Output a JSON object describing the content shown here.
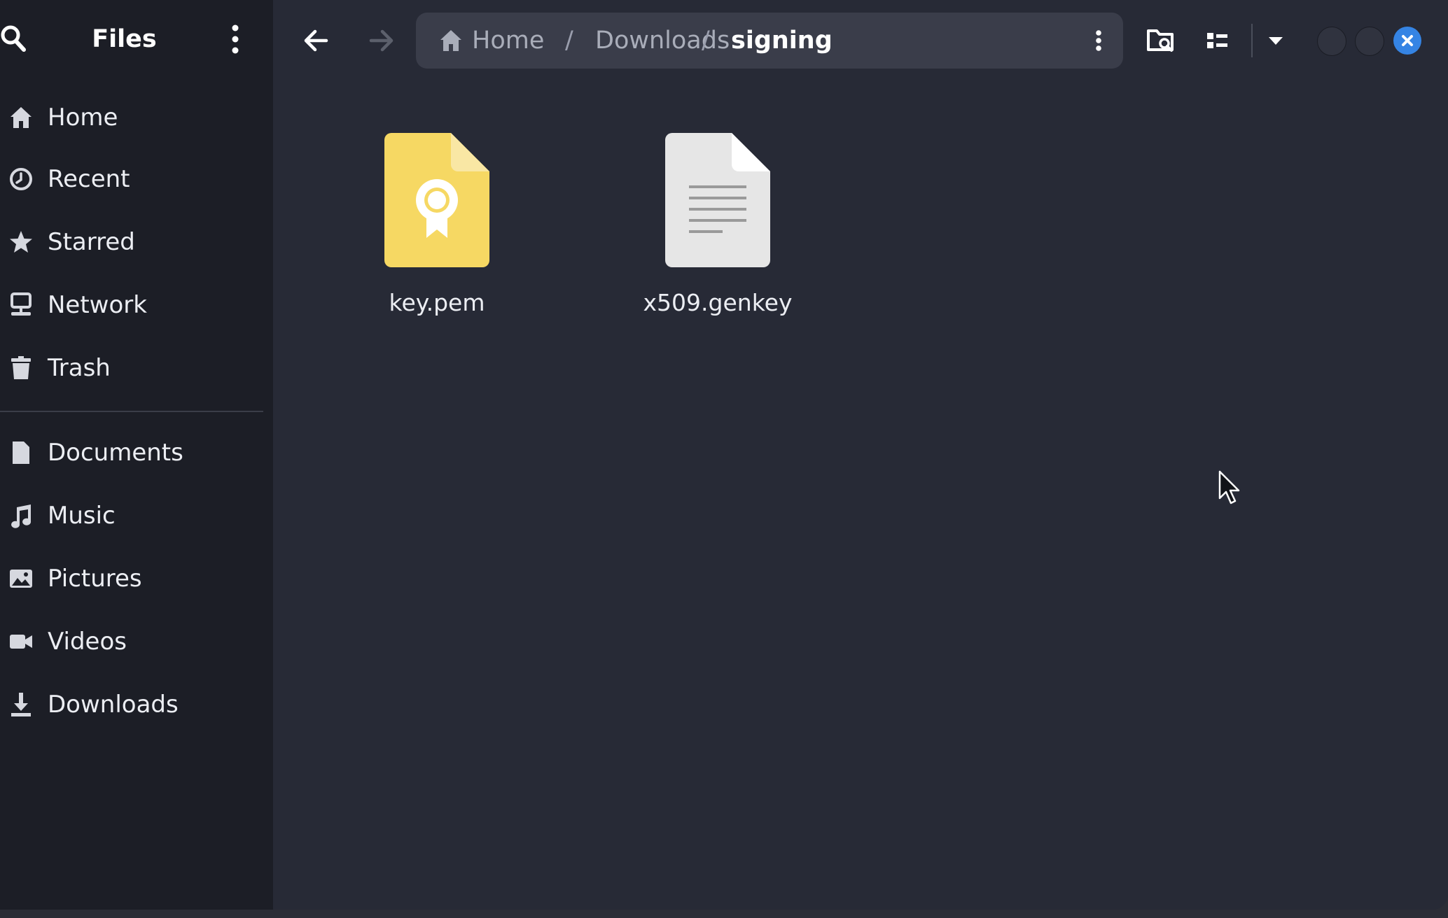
{
  "app": {
    "title": "Files"
  },
  "sidebar": {
    "places": [
      {
        "label": "Home",
        "icon": "home-icon"
      },
      {
        "label": "Recent",
        "icon": "clock-icon"
      },
      {
        "label": "Starred",
        "icon": "star-icon"
      },
      {
        "label": "Network",
        "icon": "network-icon"
      },
      {
        "label": "Trash",
        "icon": "trash-icon"
      }
    ],
    "bookmarks": [
      {
        "label": "Documents",
        "icon": "document-icon"
      },
      {
        "label": "Music",
        "icon": "music-icon"
      },
      {
        "label": "Pictures",
        "icon": "pictures-icon"
      },
      {
        "label": "Videos",
        "icon": "video-icon"
      },
      {
        "label": "Downloads",
        "icon": "download-icon"
      }
    ]
  },
  "breadcrumb": {
    "items": [
      "Home",
      "Downloads",
      "signing"
    ],
    "separator": "/"
  },
  "files": [
    {
      "name": "key.pem",
      "icon": "certificate-file-icon",
      "color": "#f6d863"
    },
    {
      "name": "x509.genkey",
      "icon": "text-file-icon",
      "color": "#e6e6e6"
    }
  ],
  "colors": {
    "accent": "#3584e4",
    "sidebar_bg": "#1c1e26",
    "content_bg": "#272a36"
  }
}
